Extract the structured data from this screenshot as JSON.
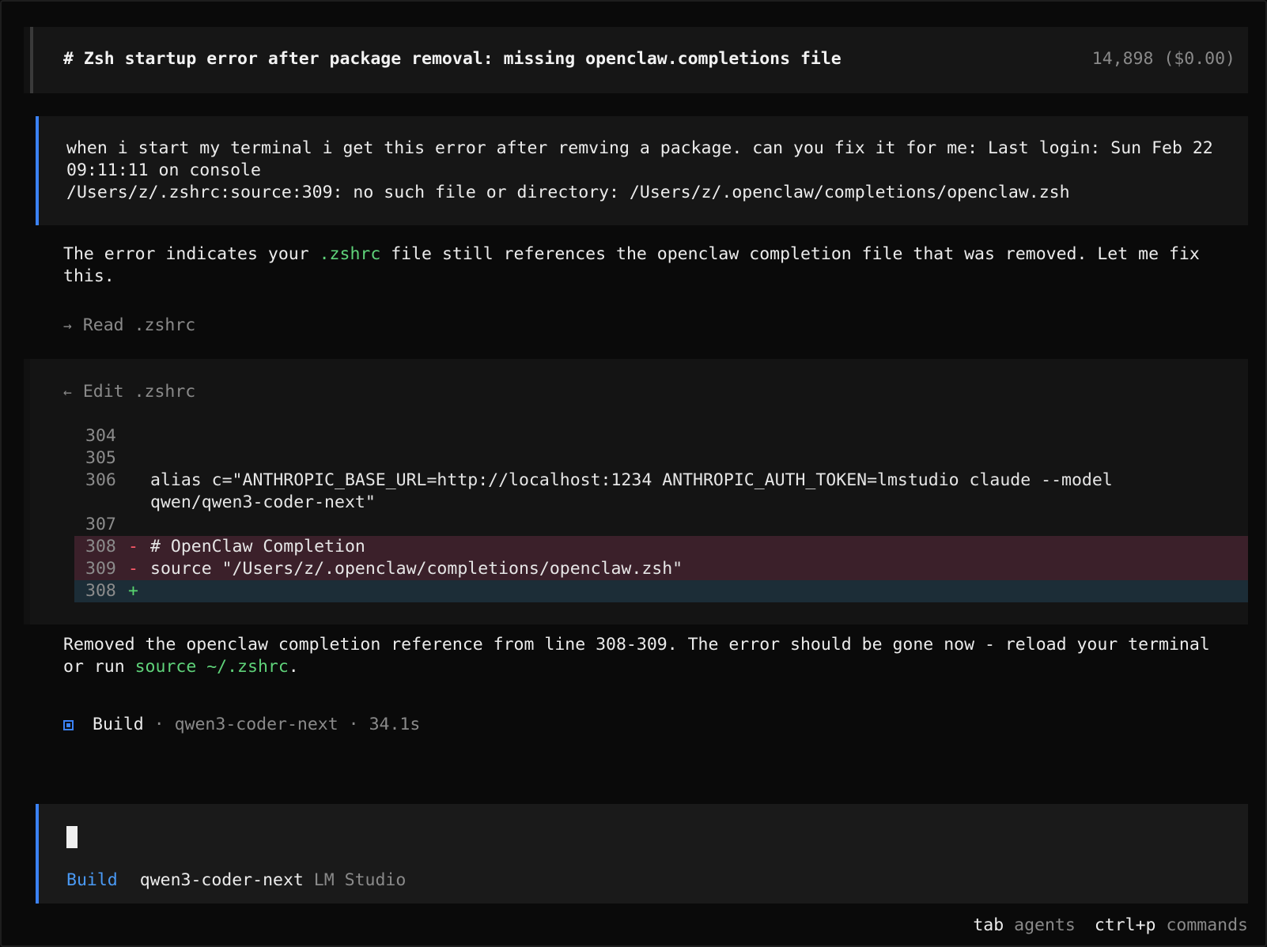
{
  "header": {
    "title": "# Zsh startup error after package removal: missing openclaw.completions file",
    "tokens": "14,898 ($0.00)"
  },
  "user_message": {
    "text": "when i start my terminal i get this error after remving a package. can you fix it for me: Last login: Sun Feb 22 09:11:11 on console\n/Users/z/.zshrc:source:309: no such file or directory: /Users/z/.openclaw/completions/openclaw.zsh"
  },
  "assistant": {
    "intro_before": "The error indicates your ",
    "intro_code": ".zshrc",
    "intro_after": " file still references the openclaw completion file that was removed. Let me fix this.",
    "read_tool": {
      "arrow": "→",
      "label": "Read .zshrc"
    },
    "edit_tool": {
      "arrow": "←",
      "label": "Edit .zshrc",
      "lines": [
        {
          "num": "304",
          "sign": "",
          "text": "",
          "kind": "ctx"
        },
        {
          "num": "305",
          "sign": "",
          "text": "",
          "kind": "ctx"
        },
        {
          "num": "306",
          "sign": "",
          "text": "alias c=\"ANTHROPIC_BASE_URL=http://localhost:1234 ANTHROPIC_AUTH_TOKEN=lmstudio claude --model qwen/qwen3-coder-next\"",
          "kind": "ctx"
        },
        {
          "num": "307",
          "sign": "",
          "text": "",
          "kind": "ctx"
        },
        {
          "num": "308",
          "sign": "-",
          "text": "# OpenClaw Completion",
          "kind": "del"
        },
        {
          "num": "309",
          "sign": "-",
          "text": "source \"/Users/z/.openclaw/completions/openclaw.zsh\"",
          "kind": "del"
        },
        {
          "num": "308",
          "sign": "+",
          "text": "",
          "kind": "add"
        }
      ]
    },
    "result_before": "Removed the openclaw completion reference from line 308-309. The error should be gone now - reload your terminal or run ",
    "result_code": "source ~/.zshrc",
    "result_after": ".",
    "status": {
      "agent": "Build",
      "dot1": "·",
      "model": "qwen3-coder-next",
      "dot2": "·",
      "duration": "34.1s"
    }
  },
  "input": {
    "mode": "Build",
    "model": "qwen3-coder-next",
    "provider": "LM Studio"
  },
  "hints": [
    {
      "key": "tab",
      "desc": "agents"
    },
    {
      "key": "ctrl+p",
      "desc": "commands"
    }
  ],
  "colors": {
    "accent": "#3b82f6",
    "code": "#5fd37a",
    "deleted_bg": "#3b202a",
    "added_bg": "#1c2d37"
  }
}
